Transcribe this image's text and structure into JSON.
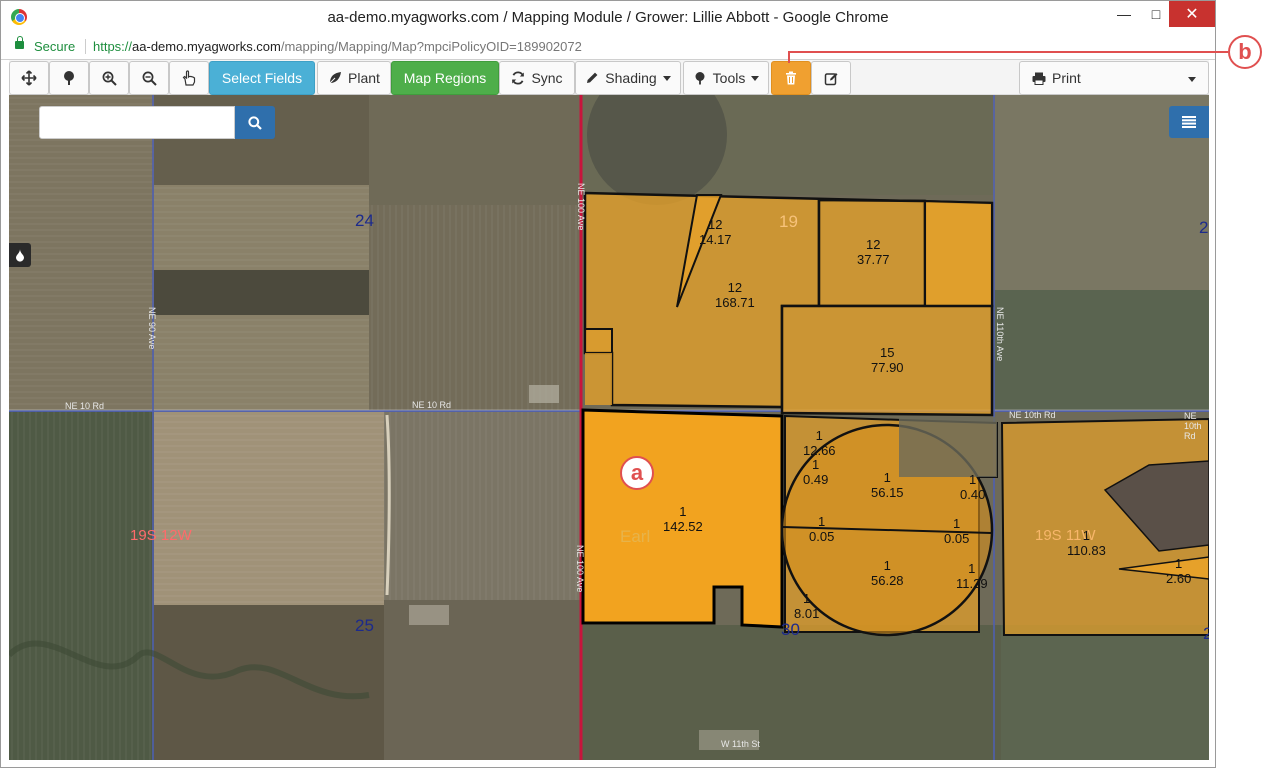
{
  "browser": {
    "title": "aa-demo.myagworks.com / Mapping Module / Grower: Lillie Abbott - Google Chrome",
    "secure_label": "Secure",
    "url_scheme": "https://",
    "url_host": "aa-demo.myagworks.com",
    "url_path": "/mapping/Mapping/Map?mpciPolicyOID=189902072",
    "minimize": "—",
    "maximize": "□",
    "close": "✕"
  },
  "toolbar": {
    "select_fields": "Select Fields",
    "plant": "Plant",
    "map_regions": "Map Regions",
    "sync": "Sync",
    "shading": "Shading",
    "tools": "Tools",
    "print": "Print"
  },
  "search": {
    "value": "",
    "placeholder": ""
  },
  "map": {
    "sections": [
      "24",
      "25",
      "19",
      "30",
      "2",
      "2"
    ],
    "townships": [
      "19S 12W",
      "19S 11W"
    ],
    "watermark": "Earl",
    "roads": [
      "NE 10 Rd",
      "NE 10 Rd",
      "NE 10th Rd",
      "NE 10th Rd",
      "NE 90 Ave",
      "NE 100 Ave",
      "NE 100 Ave",
      "NE 110th Ave",
      "W 11th St"
    ],
    "field_labels": [
      "12\n14.17",
      "12\n168.71",
      "12\n37.77",
      "15\n77.90",
      "1\n142.52",
      "1\n12.66",
      "1\n0.49",
      "1\n56.15",
      "1\n0.40",
      "1\n0.05",
      "1\n0.05",
      "1\n56.28",
      "1\n11.29",
      "1\n8.01",
      "1\n110.83",
      "1\n2.60"
    ]
  },
  "callouts": {
    "a": "a",
    "b": "b"
  }
}
